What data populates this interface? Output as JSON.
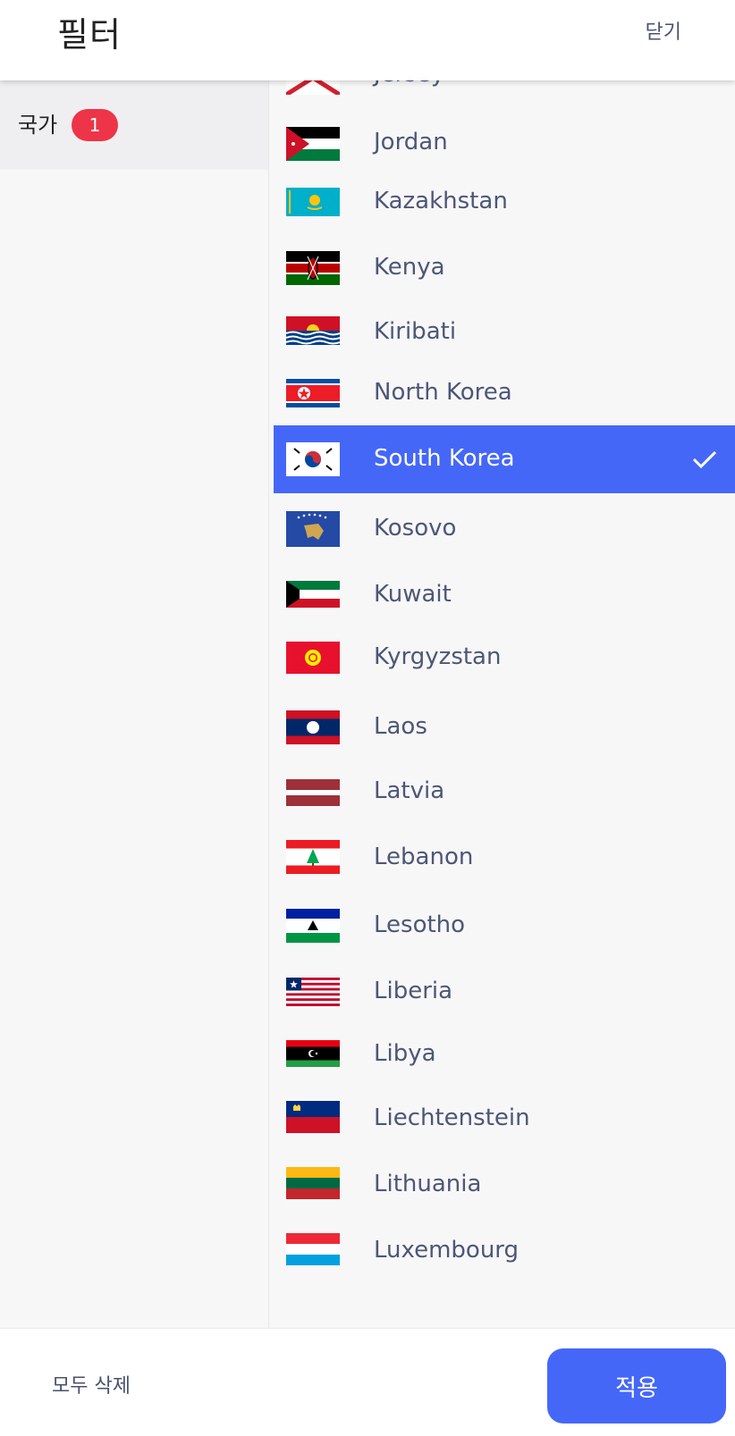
{
  "header": {
    "title": "필터",
    "close_label": "닫기"
  },
  "sidebar": {
    "category_label": "국가",
    "category_count": "1"
  },
  "countries": [
    {
      "name": "Jersey",
      "flag": "jersey-flag"
    },
    {
      "name": "Jordan",
      "flag": "jordan-flag"
    },
    {
      "name": "Kazakhstan",
      "flag": "kazakhstan-flag"
    },
    {
      "name": "Kenya",
      "flag": "kenya-flag"
    },
    {
      "name": "Kiribati",
      "flag": "kiribati-flag"
    },
    {
      "name": "North Korea",
      "flag": "north-korea-flag"
    },
    {
      "name": "South Korea",
      "flag": "south-korea-flag",
      "selected": true
    },
    {
      "name": "Kosovo",
      "flag": "kosovo-flag"
    },
    {
      "name": "Kuwait",
      "flag": "kuwait-flag"
    },
    {
      "name": "Kyrgyzstan",
      "flag": "kyrgyzstan-flag"
    },
    {
      "name": "Laos",
      "flag": "laos-flag"
    },
    {
      "name": "Latvia",
      "flag": "latvia-flag"
    },
    {
      "name": "Lebanon",
      "flag": "lebanon-flag"
    },
    {
      "name": "Lesotho",
      "flag": "lesotho-flag"
    },
    {
      "name": "Liberia",
      "flag": "liberia-flag"
    },
    {
      "name": "Libya",
      "flag": "libya-flag"
    },
    {
      "name": "Liechtenstein",
      "flag": "liechtenstein-flag"
    },
    {
      "name": "Lithuania",
      "flag": "lithuania-flag"
    },
    {
      "name": "Luxembourg",
      "flag": "luxembourg-flag"
    }
  ],
  "footer": {
    "clear_label": "모두 삭제",
    "apply_label": "적용"
  },
  "colors": {
    "accent": "#4567f8",
    "badge": "#ee3448"
  }
}
